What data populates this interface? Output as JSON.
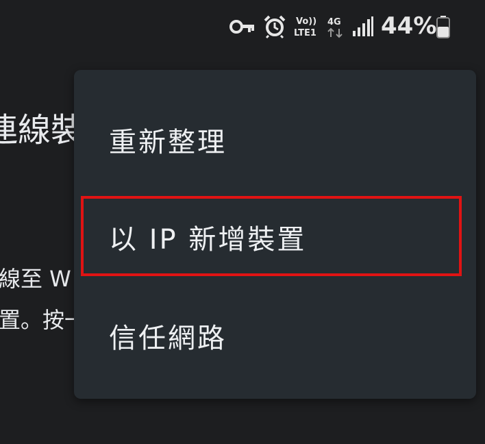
{
  "status_bar": {
    "icons": [
      "key-icon",
      "alarm-icon",
      "volte-lte1-icon",
      "network-4g-icon",
      "signal-icon",
      "battery-icon"
    ],
    "volte_top": "Vo))",
    "volte_bottom": "LTE1",
    "network_type": "4G",
    "battery_percent": "44%"
  },
  "background": {
    "title_fragment": "連線裝",
    "body_line1_fragment": "線至 W",
    "body_line2_fragment": "置。按一"
  },
  "menu": {
    "items": [
      {
        "label": "重新整理"
      },
      {
        "label": "以 IP 新增裝置",
        "highlighted": true
      },
      {
        "label": "信任網路"
      }
    ]
  },
  "colors": {
    "background": "#1d1e20",
    "menu_background": "#262c31",
    "highlight_border": "#e01313",
    "text": "#eef0f2"
  }
}
